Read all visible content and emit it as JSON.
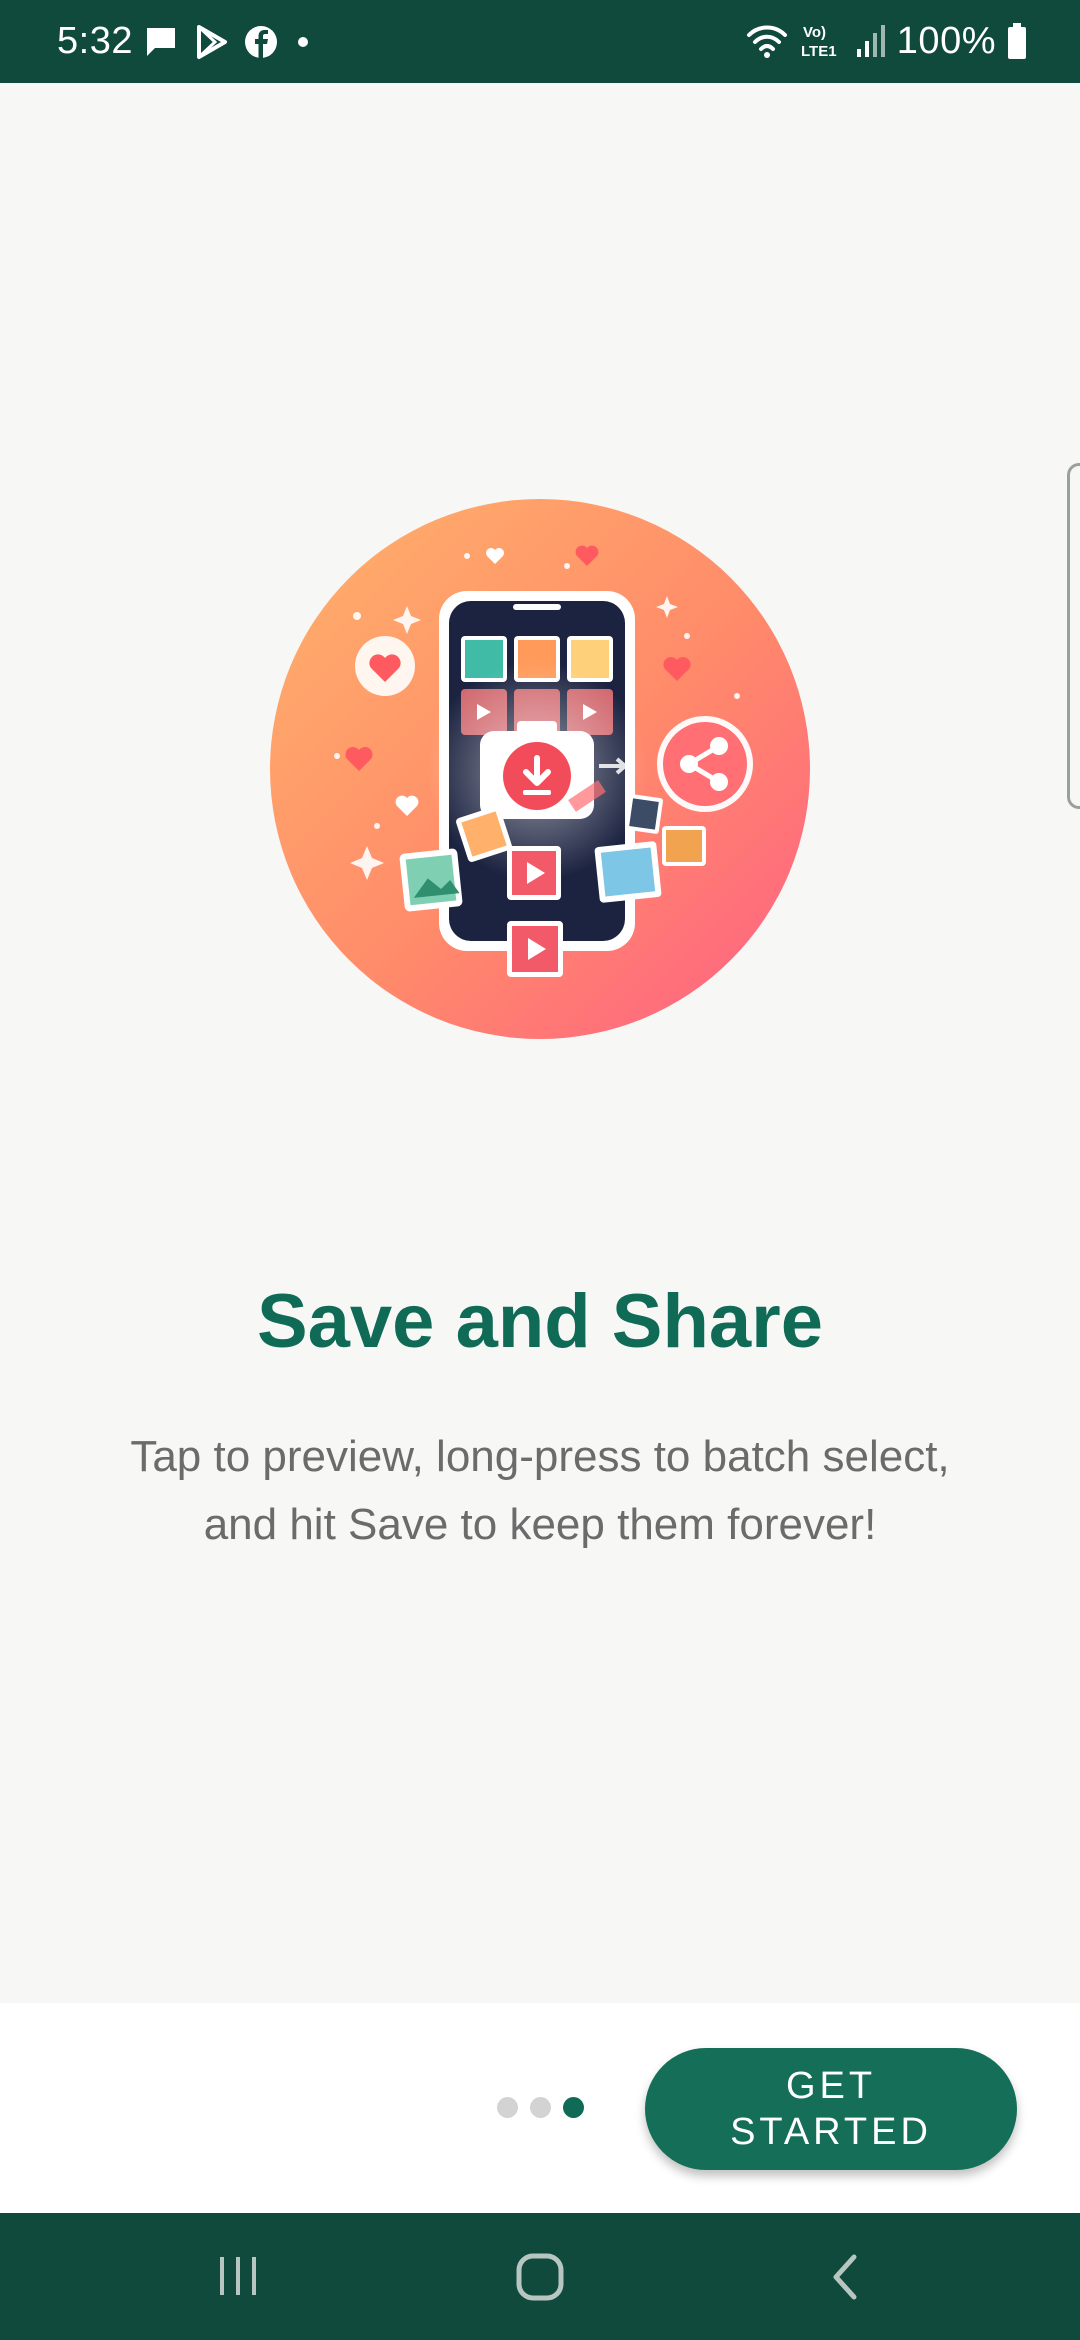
{
  "status_bar": {
    "time": "5:32",
    "battery_text": "100%",
    "left_icons": [
      "message-icon",
      "play-store-icon",
      "facebook-icon",
      "dot-icon"
    ],
    "right_icons": [
      "wifi-icon",
      "volte-icon",
      "signal-icon",
      "battery-icon"
    ],
    "volte_label_top": "Vo)",
    "volte_label_bottom": "LTE1"
  },
  "onboarding": {
    "title": "Save and Share",
    "description_line1": "Tap to preview, long-press to batch select,",
    "description_line2": "and hit Save to keep them forever!",
    "page_indicator": {
      "total": 3,
      "current": 3
    },
    "primary_button_label": "GET STARTED",
    "illustration": "save-and-share-illustration"
  },
  "nav_bar": {
    "buttons": [
      "recents-icon",
      "home-icon",
      "back-icon"
    ]
  },
  "colors": {
    "status_bar": "#0f4a3c",
    "accent": "#0f6b56",
    "button": "#156e58",
    "background": "#f7f7f6",
    "description_text": "#6b6b6b"
  }
}
